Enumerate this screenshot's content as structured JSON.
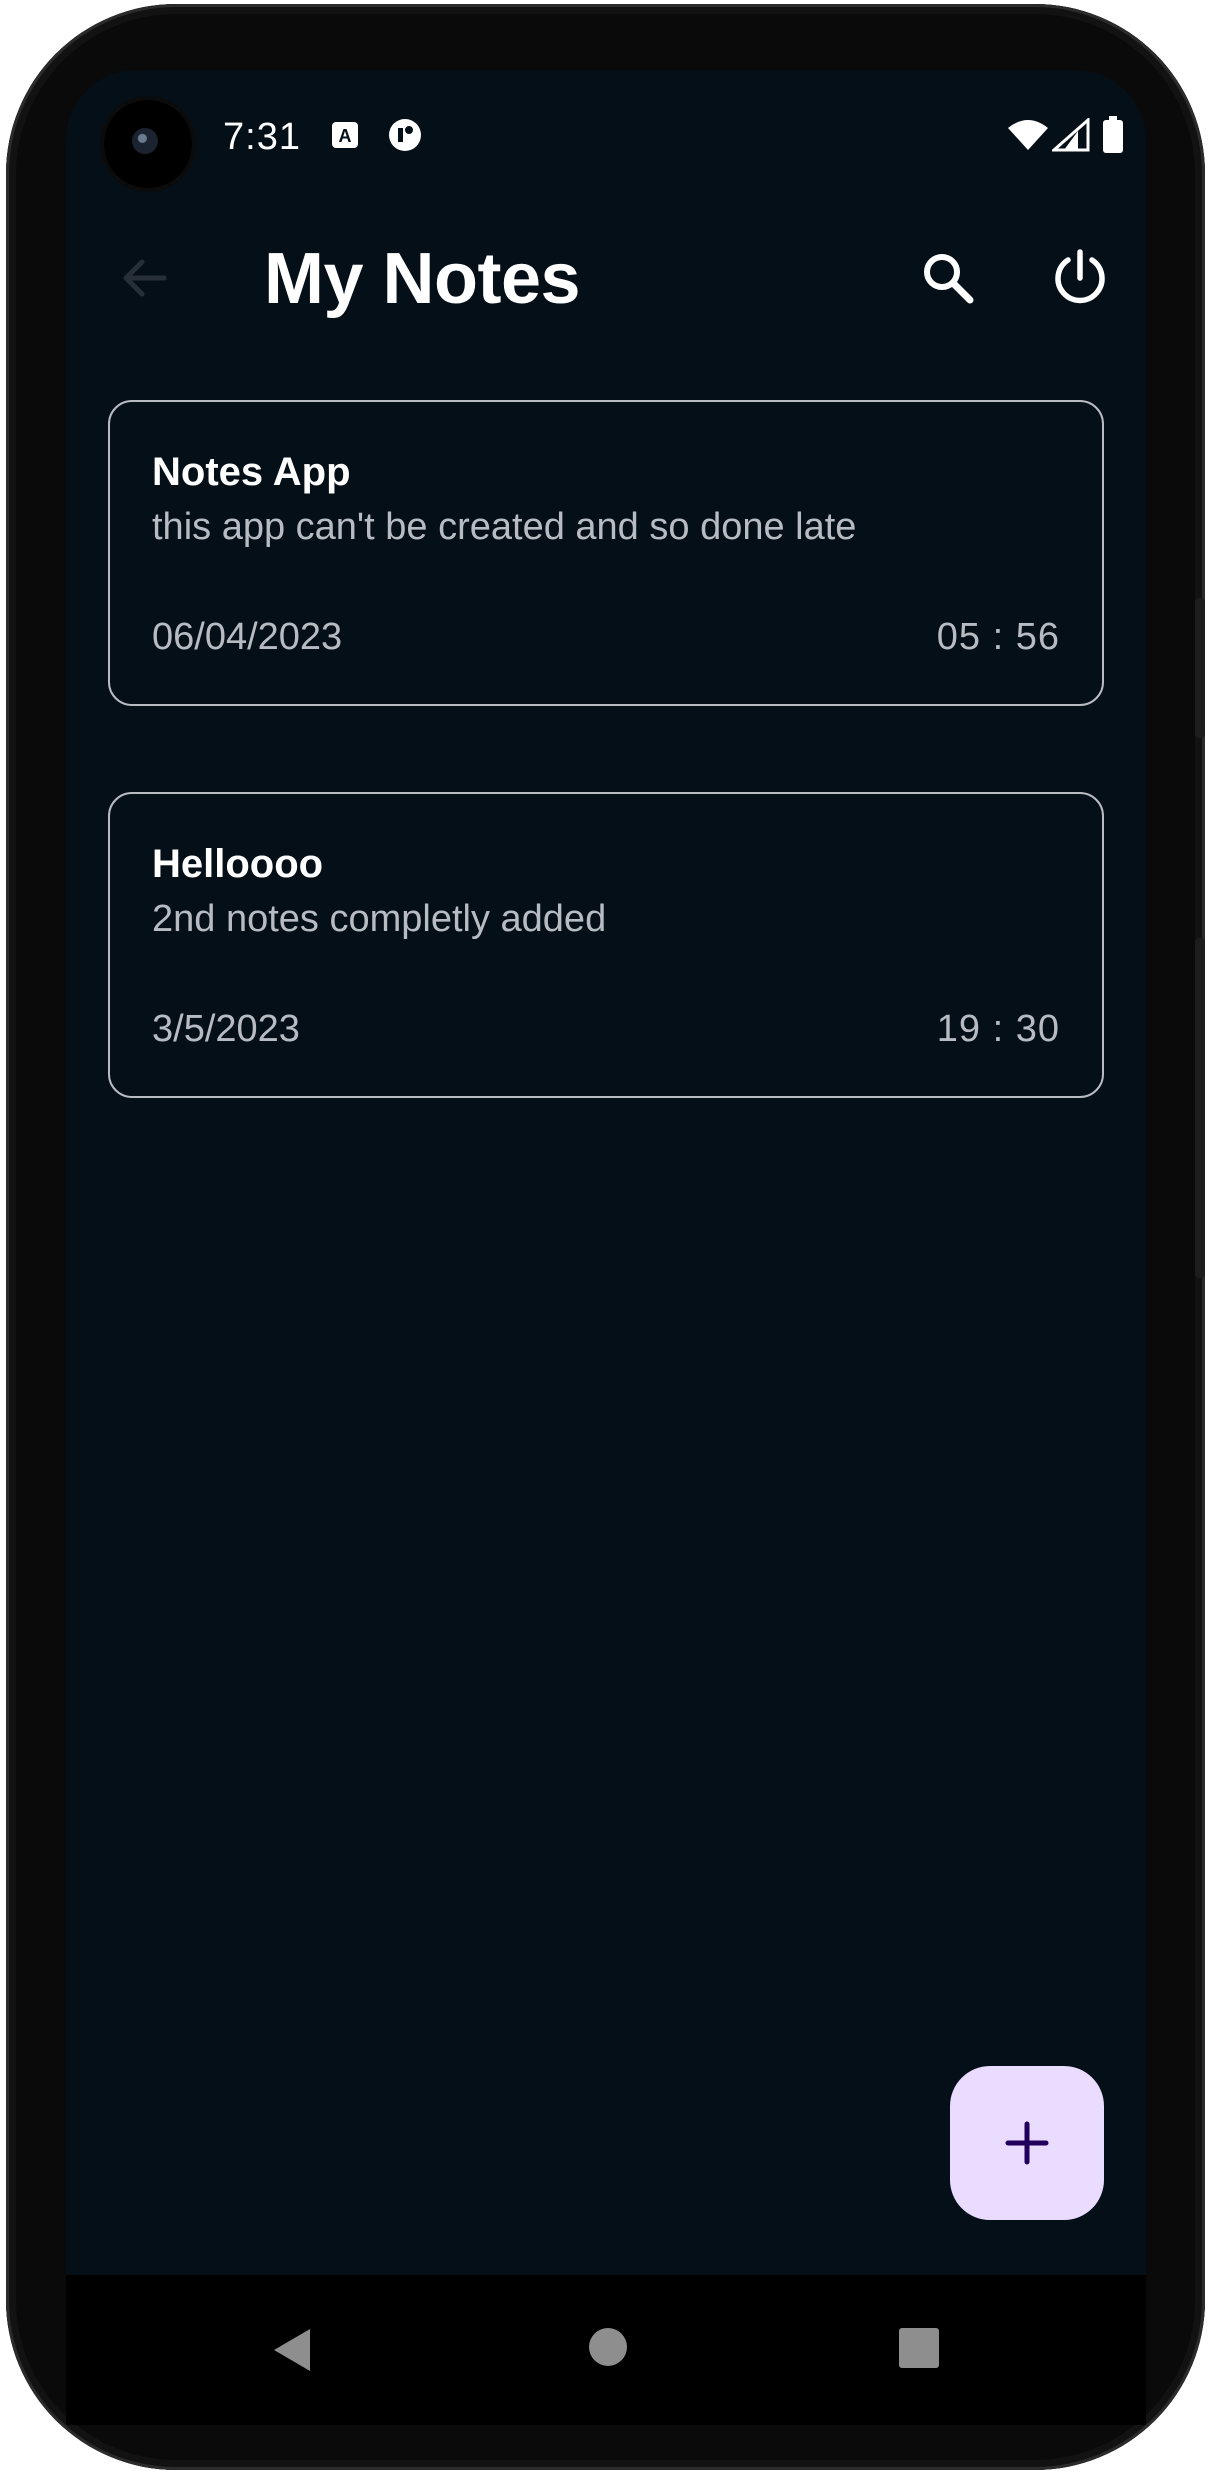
{
  "status_bar": {
    "time": "7:31",
    "icons": [
      "camera-icon",
      "a-notification-icon",
      "data-saver-icon",
      "wifi-icon",
      "signal-icon",
      "battery-icon"
    ]
  },
  "header": {
    "title": "My Notes",
    "back_icon": "arrow-left-icon",
    "search_icon": "search-icon",
    "power_icon": "power-icon"
  },
  "notes": [
    {
      "title": "Notes App",
      "body": "this app can't be created and so done late",
      "date": "06/04/2023",
      "time": "05 : 56"
    },
    {
      "title": "Helloooo",
      "body": "2nd notes completly added",
      "date": "3/5/2023",
      "time": "19 : 30"
    }
  ],
  "fab": {
    "icon": "plus-icon"
  },
  "nav": {
    "back_icon": "nav-back-icon",
    "home_icon": "nav-home-icon",
    "recents_icon": "nav-recents-icon"
  },
  "colors": {
    "background": "#050f18",
    "card_border": "#b8bcc2",
    "fab_bg": "#eadcff",
    "fab_icon": "#21005d",
    "text_primary": "#ffffff",
    "text_secondary": "#b7bcc3"
  }
}
